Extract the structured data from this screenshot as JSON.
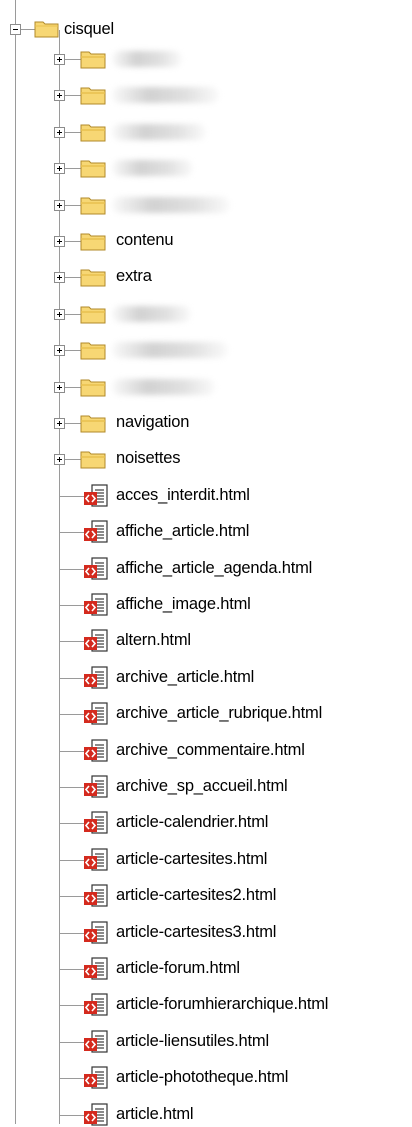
{
  "root": {
    "label": "cisquel",
    "icon": "folder-open-icon",
    "expander": "minus"
  },
  "folders": [
    {
      "label": "",
      "icon": "folder-icon",
      "obscured": true
    },
    {
      "label": "",
      "icon": "folder-icon",
      "obscured": true
    },
    {
      "label": "",
      "icon": "folder-icon",
      "obscured": true
    },
    {
      "label": "",
      "icon": "folder-icon",
      "obscured": true
    },
    {
      "label": "",
      "icon": "folder-icon",
      "obscured": true
    },
    {
      "label": "contenu",
      "icon": "folder-icon",
      "obscured": false
    },
    {
      "label": "extra",
      "icon": "folder-icon",
      "obscured": false
    },
    {
      "label": "",
      "icon": "folder-icon",
      "obscured": true
    },
    {
      "label": "",
      "icon": "folder-icon",
      "obscured": true
    },
    {
      "label": "",
      "icon": "folder-icon",
      "obscured": true
    },
    {
      "label": "navigation",
      "icon": "folder-icon",
      "obscured": false
    },
    {
      "label": "noisettes",
      "icon": "folder-icon",
      "obscured": false
    }
  ],
  "files": [
    {
      "label": "acces_interdit.html",
      "icon": "html-file-icon"
    },
    {
      "label": "affiche_article.html",
      "icon": "html-file-icon"
    },
    {
      "label": "affiche_article_agenda.html",
      "icon": "html-file-icon"
    },
    {
      "label": "affiche_image.html",
      "icon": "html-file-icon"
    },
    {
      "label": "altern.html",
      "icon": "html-file-icon"
    },
    {
      "label": "archive_article.html",
      "icon": "html-file-icon"
    },
    {
      "label": "archive_article_rubrique.html",
      "icon": "html-file-icon"
    },
    {
      "label": "archive_commentaire.html",
      "icon": "html-file-icon"
    },
    {
      "label": "archive_sp_accueil.html",
      "icon": "html-file-icon"
    },
    {
      "label": "article-calendrier.html",
      "icon": "html-file-icon"
    },
    {
      "label": "article-cartesites.html",
      "icon": "html-file-icon"
    },
    {
      "label": "article-cartesites2.html",
      "icon": "html-file-icon"
    },
    {
      "label": "article-cartesites3.html",
      "icon": "html-file-icon"
    },
    {
      "label": "article-forum.html",
      "icon": "html-file-icon"
    },
    {
      "label": "article-forumhierarchique.html",
      "icon": "html-file-icon"
    },
    {
      "label": "article-liensutiles.html",
      "icon": "html-file-icon"
    },
    {
      "label": "article-phototheque.html",
      "icon": "html-file-icon"
    },
    {
      "label": "article.html",
      "icon": "html-file-icon"
    }
  ],
  "colors": {
    "folder_fill": "#f7d774",
    "folder_edge": "#b08a2a",
    "file_red": "#d42a1e",
    "tree_lines": "#9a9a9a"
  }
}
